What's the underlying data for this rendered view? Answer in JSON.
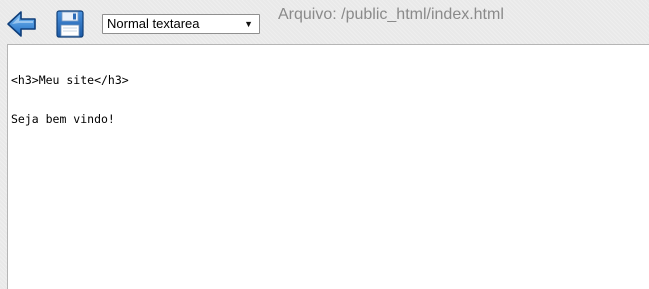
{
  "toolbar": {
    "back_icon": "back-arrow-icon",
    "save_icon": "floppy-disk-icon",
    "mode_select": {
      "selected": "Normal textarea"
    },
    "file_label": "Arquivo: /public_html/index.html"
  },
  "editor": {
    "lines": [
      "<h3>Meu site</h3>",
      "Seja bem vindo!"
    ]
  },
  "colors": {
    "toolbar_bg": "#e9e9e9",
    "icon_blue": "#2f7dd1",
    "icon_dark_blue": "#1c5aa6",
    "editor_bg": "#ffffff",
    "file_label_text": "#8a8a8a"
  }
}
